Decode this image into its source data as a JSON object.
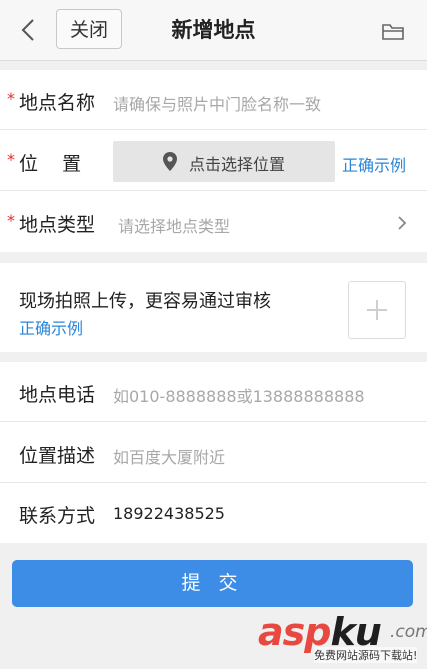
{
  "header": {
    "close_label": "关闭",
    "title": "新增地点"
  },
  "form": {
    "required_mark": "*",
    "name": {
      "label": "地点名称",
      "placeholder": "请确保与照片中门脸名称一致"
    },
    "location": {
      "label": "位    置",
      "button_label": "点击选择位置",
      "example_link": "正确示例"
    },
    "type": {
      "label": "地点类型",
      "placeholder": "请选择地点类型"
    }
  },
  "photo": {
    "title": "现场拍照上传，更容易通过审核",
    "example_link": "正确示例"
  },
  "contact": {
    "phone": {
      "label": "地点电话",
      "placeholder": "如010-8888888或13888888888"
    },
    "description": {
      "label": "位置描述",
      "placeholder": "如百度大厦附近"
    },
    "method": {
      "label": "联系方式",
      "value": "18922438525"
    }
  },
  "submit_label": "提 交",
  "watermark": {
    "brand_a": "asp",
    "brand_b": "ku",
    "brand_c": ".com",
    "subtitle": "免费网站源码下载站!"
  },
  "colors": {
    "accent": "#3d8ce6",
    "link": "#2a86d6",
    "required": "#e03030"
  },
  "icons": [
    "back-arrow-icon",
    "folder-icon",
    "location-pin-icon",
    "chevron-right-icon",
    "plus-icon"
  ]
}
